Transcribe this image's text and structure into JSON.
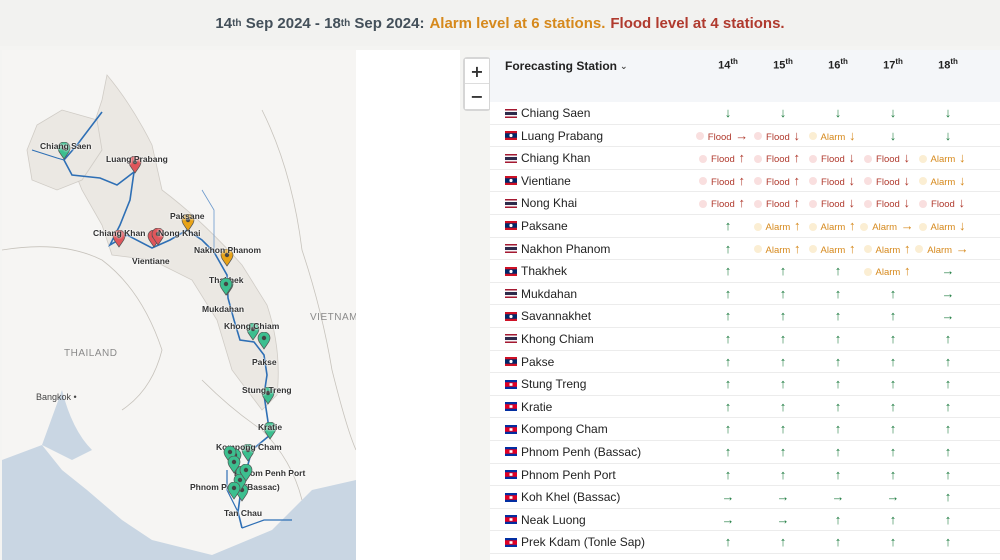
{
  "banner": {
    "date_start_day": "14",
    "date_start_sup": "th",
    "date_start_rest": "Sep 2024 -",
    "date_end_day": "18",
    "date_end_sup": "th",
    "date_end_rest": "Sep 2024:",
    "alarm_text": "Alarm level at 6 stations.",
    "flood_text": "Flood level at 4 stations."
  },
  "zoom": {
    "in_label": "+",
    "out_label": "−"
  },
  "map": {
    "countries": [
      "THAILAND",
      "VIETNAM"
    ],
    "city": "Bangkok",
    "stations": [
      {
        "label": "Chiang Saen",
        "status": "normal"
      },
      {
        "label": "Luang Prabang",
        "status": "flood"
      },
      {
        "label": "Chiang Khan",
        "status": "flood"
      },
      {
        "label": "Vientiane",
        "status": "flood"
      },
      {
        "label": "Nong Khai",
        "status": "flood"
      },
      {
        "label": "Paksane",
        "status": "alarm"
      },
      {
        "label": "Nakhon Phanom",
        "status": "alarm"
      },
      {
        "label": "Thakhek",
        "status": "normal"
      },
      {
        "label": "Mukdahan",
        "status": "normal"
      },
      {
        "label": "Khong Chiam",
        "status": "normal"
      },
      {
        "label": "Pakse",
        "status": "normal"
      },
      {
        "label": "Stung Treng",
        "status": "normal"
      },
      {
        "label": "Kratie",
        "status": "normal"
      },
      {
        "label": "Kompong Cham",
        "status": "normal"
      },
      {
        "label": "Phnom Penh Port",
        "status": "normal"
      },
      {
        "label": "Phnom Penh (Bassac)",
        "status": "normal"
      },
      {
        "label": "Tan Chau",
        "status": "normal"
      }
    ]
  },
  "table": {
    "station_header": "Forecasting Station",
    "days": [
      {
        "num": "14",
        "sup": "th"
      },
      {
        "num": "15",
        "sup": "th"
      },
      {
        "num": "16",
        "sup": "th"
      },
      {
        "num": "17",
        "sup": "th"
      },
      {
        "num": "18",
        "sup": "th"
      }
    ],
    "rows": [
      {
        "name": "Chiang Saen",
        "country": "TH",
        "cells": [
          [
            "normal",
            "↓"
          ],
          [
            "normal",
            "↓"
          ],
          [
            "normal",
            "↓"
          ],
          [
            "normal",
            "↓"
          ],
          [
            "normal",
            "↓"
          ]
        ]
      },
      {
        "name": "Luang Prabang",
        "country": "LA",
        "cells": [
          [
            "flood",
            "→",
            "Flood"
          ],
          [
            "flood",
            "↓",
            "Flood"
          ],
          [
            "alarm",
            "↓",
            "Alarm"
          ],
          [
            "normal",
            "↓"
          ],
          [
            "normal",
            "↓"
          ]
        ]
      },
      {
        "name": "Chiang Khan",
        "country": "TH",
        "cells": [
          [
            "flood",
            "↑",
            "Flood"
          ],
          [
            "flood",
            "↑",
            "Flood"
          ],
          [
            "flood",
            "↓",
            "Flood"
          ],
          [
            "flood",
            "↓",
            "Flood"
          ],
          [
            "alarm",
            "↓",
            "Alarm"
          ]
        ]
      },
      {
        "name": "Vientiane",
        "country": "LA",
        "cells": [
          [
            "flood",
            "↑",
            "Flood"
          ],
          [
            "flood",
            "↑",
            "Flood"
          ],
          [
            "flood",
            "↓",
            "Flood"
          ],
          [
            "flood",
            "↓",
            "Flood"
          ],
          [
            "alarm",
            "↓",
            "Alarm"
          ]
        ]
      },
      {
        "name": "Nong Khai",
        "country": "TH",
        "cells": [
          [
            "flood",
            "↑",
            "Flood"
          ],
          [
            "flood",
            "↑",
            "Flood"
          ],
          [
            "flood",
            "↓",
            "Flood"
          ],
          [
            "flood",
            "↓",
            "Flood"
          ],
          [
            "flood",
            "↓",
            "Flood"
          ]
        ]
      },
      {
        "name": "Paksane",
        "country": "LA",
        "cells": [
          [
            "normal",
            "↑"
          ],
          [
            "alarm",
            "↑",
            "Alarm"
          ],
          [
            "alarm",
            "↑",
            "Alarm"
          ],
          [
            "alarm",
            "→",
            "Alarm"
          ],
          [
            "alarm",
            "↓",
            "Alarm"
          ]
        ]
      },
      {
        "name": "Nakhon Phanom",
        "country": "TH",
        "cells": [
          [
            "normal",
            "↑"
          ],
          [
            "alarm",
            "↑",
            "Alarm"
          ],
          [
            "alarm",
            "↑",
            "Alarm"
          ],
          [
            "alarm",
            "↑",
            "Alarm"
          ],
          [
            "alarm",
            "→",
            "Alarm"
          ]
        ]
      },
      {
        "name": "Thakhek",
        "country": "LA",
        "cells": [
          [
            "normal",
            "↑"
          ],
          [
            "normal",
            "↑"
          ],
          [
            "normal",
            "↑"
          ],
          [
            "alarm",
            "↑",
            "Alarm"
          ],
          [
            "normal",
            "→"
          ]
        ]
      },
      {
        "name": "Mukdahan",
        "country": "TH",
        "cells": [
          [
            "normal",
            "↑"
          ],
          [
            "normal",
            "↑"
          ],
          [
            "normal",
            "↑"
          ],
          [
            "normal",
            "↑"
          ],
          [
            "normal",
            "→"
          ]
        ]
      },
      {
        "name": "Savannakhet",
        "country": "LA",
        "cells": [
          [
            "normal",
            "↑"
          ],
          [
            "normal",
            "↑"
          ],
          [
            "normal",
            "↑"
          ],
          [
            "normal",
            "↑"
          ],
          [
            "normal",
            "→"
          ]
        ]
      },
      {
        "name": "Khong Chiam",
        "country": "TH",
        "cells": [
          [
            "normal",
            "↑"
          ],
          [
            "normal",
            "↑"
          ],
          [
            "normal",
            "↑"
          ],
          [
            "normal",
            "↑"
          ],
          [
            "normal",
            "↑"
          ]
        ]
      },
      {
        "name": "Pakse",
        "country": "LA",
        "cells": [
          [
            "normal",
            "↑"
          ],
          [
            "normal",
            "↑"
          ],
          [
            "normal",
            "↑"
          ],
          [
            "normal",
            "↑"
          ],
          [
            "normal",
            "↑"
          ]
        ]
      },
      {
        "name": "Stung Treng",
        "country": "KH",
        "cells": [
          [
            "normal",
            "↑"
          ],
          [
            "normal",
            "↑"
          ],
          [
            "normal",
            "↑"
          ],
          [
            "normal",
            "↑"
          ],
          [
            "normal",
            "↑"
          ]
        ]
      },
      {
        "name": "Kratie",
        "country": "KH",
        "cells": [
          [
            "normal",
            "↑"
          ],
          [
            "normal",
            "↑"
          ],
          [
            "normal",
            "↑"
          ],
          [
            "normal",
            "↑"
          ],
          [
            "normal",
            "↑"
          ]
        ]
      },
      {
        "name": "Kompong Cham",
        "country": "KH",
        "cells": [
          [
            "normal",
            "↑"
          ],
          [
            "normal",
            "↑"
          ],
          [
            "normal",
            "↑"
          ],
          [
            "normal",
            "↑"
          ],
          [
            "normal",
            "↑"
          ]
        ]
      },
      {
        "name": "Phnom Penh (Bassac)",
        "country": "KH",
        "cells": [
          [
            "normal",
            "↑"
          ],
          [
            "normal",
            "↑"
          ],
          [
            "normal",
            "↑"
          ],
          [
            "normal",
            "↑"
          ],
          [
            "normal",
            "↑"
          ]
        ]
      },
      {
        "name": "Phnom Penh Port",
        "country": "KH",
        "cells": [
          [
            "normal",
            "↑"
          ],
          [
            "normal",
            "↑"
          ],
          [
            "normal",
            "↑"
          ],
          [
            "normal",
            "↑"
          ],
          [
            "normal",
            "↑"
          ]
        ]
      },
      {
        "name": "Koh Khel (Bassac)",
        "country": "KH",
        "cells": [
          [
            "normal",
            "→"
          ],
          [
            "normal",
            "→"
          ],
          [
            "normal",
            "→"
          ],
          [
            "normal",
            "→"
          ],
          [
            "normal",
            "↑"
          ]
        ]
      },
      {
        "name": "Neak Luong",
        "country": "KH",
        "cells": [
          [
            "normal",
            "→"
          ],
          [
            "normal",
            "→"
          ],
          [
            "normal",
            "↑"
          ],
          [
            "normal",
            "↑"
          ],
          [
            "normal",
            "↑"
          ]
        ]
      },
      {
        "name": "Prek Kdam (Tonle Sap)",
        "country": "KH",
        "cells": [
          [
            "normal",
            "↑"
          ],
          [
            "normal",
            "↑"
          ],
          [
            "normal",
            "↑"
          ],
          [
            "normal",
            "↑"
          ],
          [
            "normal",
            "↑"
          ]
        ]
      }
    ]
  },
  "colors": {
    "normal": "#1b7a3e",
    "alarm": "#d6891c",
    "flood": "#b03a2e",
    "pin_normal": "#3cbf8f",
    "pin_alarm": "#e8a317",
    "pin_flood": "#e0565b"
  },
  "icons": {
    "sort": "chevron-down-icon",
    "up": "arrow-up-icon",
    "down": "arrow-down-icon",
    "right": "arrow-right-icon"
  }
}
